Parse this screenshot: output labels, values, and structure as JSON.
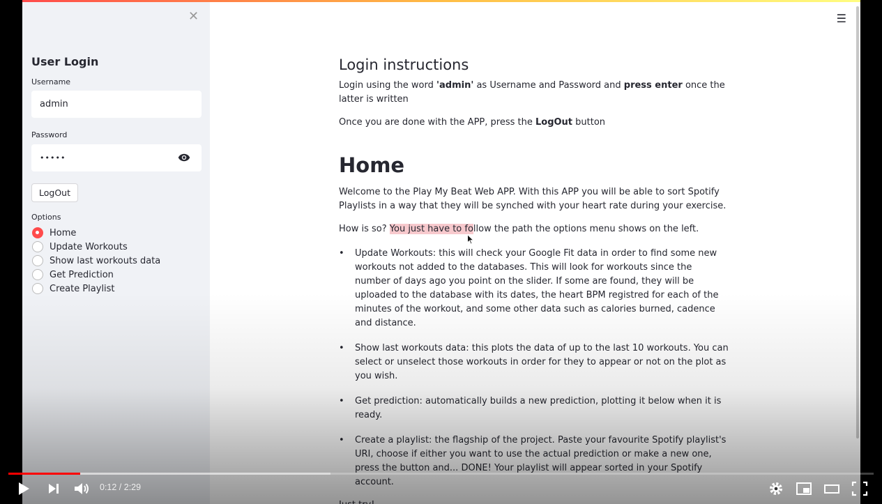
{
  "sidebar": {
    "title": "User Login",
    "username_label": "Username",
    "username_value": "admin",
    "password_label": "Password",
    "password_value": "•••••",
    "logout_label": "LogOut",
    "options_label": "Options",
    "options": [
      {
        "label": "Home",
        "selected": true
      },
      {
        "label": "Update Workouts",
        "selected": false
      },
      {
        "label": "Show last workouts data",
        "selected": false
      },
      {
        "label": "Get Prediction",
        "selected": false
      },
      {
        "label": "Create Playlist",
        "selected": false
      }
    ]
  },
  "main": {
    "login_heading": "Login instructions",
    "login_p1_a": "Login using the word ",
    "login_p1_b": "'admin'",
    "login_p1_c": " as Username and Password and ",
    "login_p1_d": "press enter",
    "login_p1_e": " once the latter is written",
    "login_p2_a": "Once you are done with the APP, press the ",
    "login_p2_b": "LogOut",
    "login_p2_c": " button",
    "home_heading": "Home",
    "home_p1": "Welcome to the Play My Beat Web APP. With this APP you will be able to sort Spotify Playlists in a way that they will be synched with your heart rate during your exercise.",
    "home_p2_a": "How is so? ",
    "home_p2_b": "You just have to fo",
    "home_p2_c": "llow the path the options menu shows on the left.",
    "bullets": [
      "Update Workouts: this will check your Google Fit data in order to find some new workouts not added to the databases. This will look for workouts since the number of days ago you point on the slider. If some are found, they will be uploaded to the database with its dates, the heart BPM registred for each of the minutes of the workout, and some other data such as calories burned, cadence and distance.",
      "Show last workouts data: this plots the data of up to the last 10 workouts. You can select or unselect those workouts in order for they to appear or not on the plot as you wish.",
      "Get prediction: automatically builds a new prediction, plotting it below when it is ready.",
      "Create a playlist: the flagship of the project. Paste your favourite Spotify playlist's URI, choose if either you want to use the actual prediction or make a new one, press the button and... DONE! Your playlist will appear sorted in your Spotify account."
    ],
    "footer": "Just try!"
  },
  "player": {
    "time_display": "0:12 / 2:29",
    "played_fraction": 0.0826,
    "buffered_fraction": 0.372,
    "accent_color": "#ff0000"
  },
  "colors": {
    "streamlit_primary": "#ff4b4b",
    "sidebar_bg": "#f0f2f6",
    "highlight": "#f7c9cd"
  }
}
